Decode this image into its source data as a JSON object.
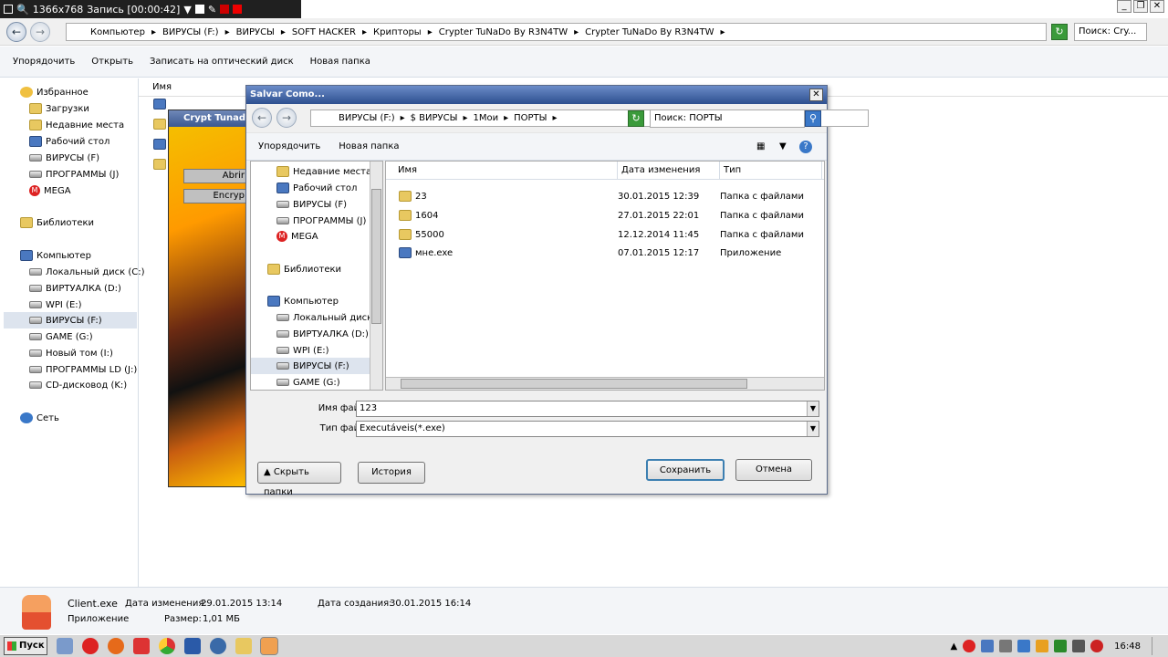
{
  "recorder": {
    "resolution": "1366x768",
    "status": "Запись [00:00:42]"
  },
  "explorer": {
    "breadcrumb": [
      "Компьютер",
      "ВИРУСЫ (F:)",
      "ВИРУСЫ",
      "SOFT HACKER",
      "Крипторы",
      "Crypter TuNaDo By R3N4TW",
      "Crypter TuNaDo By R3N4TW"
    ],
    "search_placeholder": "Поиск: Cry...",
    "toolbar": {
      "organize": "Упорядочить",
      "open": "Открыть",
      "burn": "Записать на оптический диск",
      "new_folder": "Новая папка"
    },
    "col_name": "Имя",
    "sidebar": {
      "favorites": "Избранное",
      "downloads": "Загрузки",
      "recent": "Недавние места",
      "desktop": "Рабочий стол",
      "viruses": "ВИРУСЫ (F)",
      "programs": "ПРОГРАММЫ (J)",
      "mega": "MEGA",
      "libraries": "Библиотеки",
      "computer": "Компьютер",
      "c": "Локальный диск (C:)",
      "d": "ВИРТУАЛКА (D:)",
      "e": "WPI (E:)",
      "f": "ВИРУСЫ (F:)",
      "g": "GAME (G:)",
      "i": "Новый том (I:)",
      "j": "ПРОГРАММЫ LD (J:)",
      "k": "CD-дисковод (K:)",
      "network": "Сеть"
    }
  },
  "crypter": {
    "title": "Crypt Tunad",
    "btn1": "Abrir",
    "btn2": "Encryp"
  },
  "dialog": {
    "title": "Salvar Como...",
    "breadcrumb": [
      "ВИРУСЫ (F:)",
      "$ ВИРУСЫ",
      "1Мои",
      "ПОРТЫ"
    ],
    "search_placeholder": "Поиск: ПОРТЫ",
    "toolbar": {
      "organize": "Упорядочить",
      "new_folder": "Новая папка"
    },
    "tree": {
      "recent": "Недавние места",
      "desktop": "Рабочий стол",
      "viruses": "ВИРУСЫ (F)",
      "programs": "ПРОГРАММЫ (J)",
      "mega": "MEGA",
      "libraries": "Библиотеки",
      "computer": "Компьютер",
      "c": "Локальный диск (",
      "d": "ВИРТУАЛКА (D:)",
      "e": "WPI (E:)",
      "f": "ВИРУСЫ (F:)",
      "g": "GAME (G:)"
    },
    "columns": {
      "name": "Имя",
      "date": "Дата изменения",
      "type": "Тип"
    },
    "files": [
      {
        "name": "23",
        "date": "30.01.2015 12:39",
        "type": "Папка с файлами"
      },
      {
        "name": "1604",
        "date": "27.01.2015 22:01",
        "type": "Папка с файлами"
      },
      {
        "name": "55000",
        "date": "12.12.2014 11:45",
        "type": "Папка с файлами"
      },
      {
        "name": "мне.exe",
        "date": "07.01.2015 12:17",
        "type": "Приложение"
      }
    ],
    "filename_label": "Имя файла:",
    "filename_value": "123",
    "filetype_label": "Тип файла:",
    "filetype_value": "Executáveis(*.exe)",
    "hide_folders": "Скрыть папки",
    "history": "История",
    "save": "Сохранить",
    "cancel": "Отмена"
  },
  "status": {
    "file": "Client.exe",
    "modified_label": "Дата изменения:",
    "modified": "29.01.2015 13:14",
    "created_label": "Дата создания:",
    "created": "30.01.2015 16:14",
    "kind": "Приложение",
    "size_label": "Размер:",
    "size": "1,01 МБ"
  },
  "taskbar": {
    "start": "Пуск",
    "clock": "16:48"
  }
}
